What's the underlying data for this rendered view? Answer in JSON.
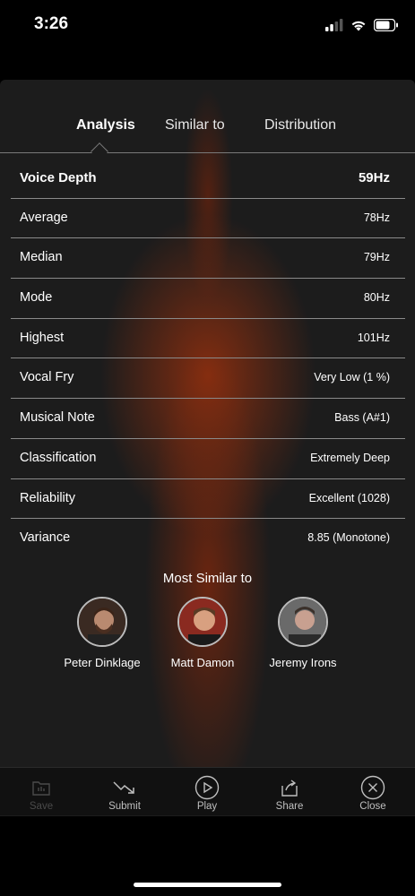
{
  "status": {
    "time": "3:26"
  },
  "tabs": [
    {
      "label": "Analysis",
      "active": true
    },
    {
      "label": "Similar to",
      "active": false
    },
    {
      "label": "Distribution",
      "active": false
    }
  ],
  "analysis": {
    "header": {
      "label": "Voice Depth",
      "value": "59Hz"
    },
    "rows": [
      {
        "label": "Average",
        "value": "78Hz"
      },
      {
        "label": "Median",
        "value": "79Hz"
      },
      {
        "label": "Mode",
        "value": "80Hz"
      },
      {
        "label": "Highest",
        "value": "101Hz"
      },
      {
        "label": "Vocal Fry",
        "value": "Very Low (1 %)"
      },
      {
        "label": "Musical Note",
        "value": "Bass (A#1)"
      },
      {
        "label": "Classification",
        "value": "Extremely Deep"
      },
      {
        "label": "Reliability",
        "value": "Excellent (1028)"
      },
      {
        "label": "Variance",
        "value": "8.85 (Monotone)"
      }
    ]
  },
  "similar": {
    "title": "Most Similar to",
    "people": [
      {
        "name": "Peter Dinklage",
        "color": "#6b4a3a"
      },
      {
        "name": "Matt Damon",
        "color": "#b0503a"
      },
      {
        "name": "Jeremy Irons",
        "color": "#5a5a5a"
      }
    ]
  },
  "toolbar": {
    "items": [
      {
        "label": "Save",
        "icon": "save-icon",
        "enabled": false
      },
      {
        "label": "Submit",
        "icon": "trend-down-icon",
        "enabled": true
      },
      {
        "label": "Play",
        "icon": "play-icon",
        "enabled": true
      },
      {
        "label": "Share",
        "icon": "share-icon",
        "enabled": true
      },
      {
        "label": "Close",
        "icon": "close-icon",
        "enabled": true
      }
    ]
  },
  "colors": {
    "accent_glow": "#96300e",
    "panel": "#1c1c1c"
  }
}
